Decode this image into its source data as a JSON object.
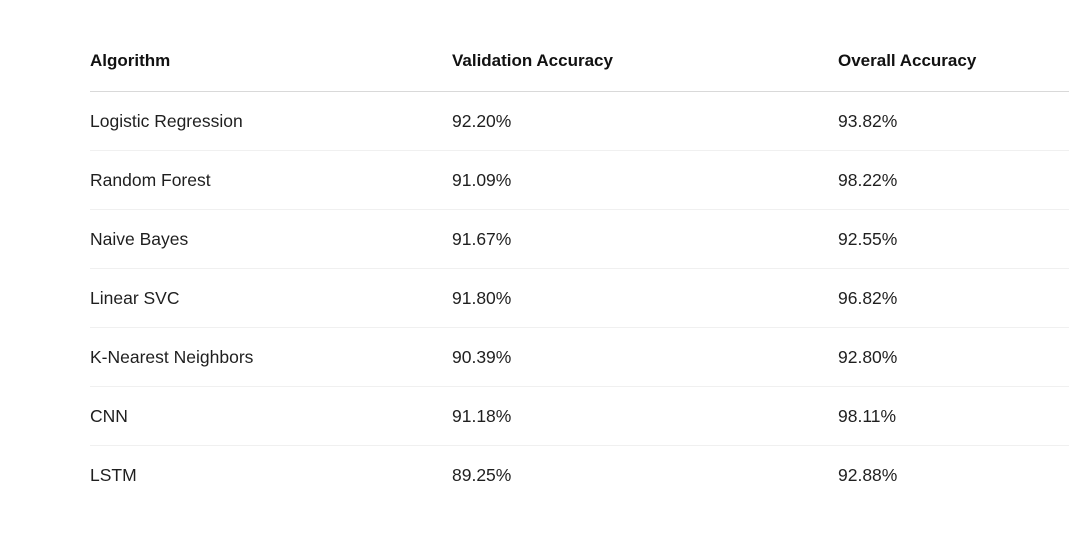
{
  "table": {
    "headers": [
      "Algorithm",
      "Validation Accuracy",
      "Overall Accuracy"
    ],
    "rows": [
      [
        "Logistic Regression",
        "92.20%",
        "93.82%"
      ],
      [
        "Random Forest",
        "91.09%",
        "98.22%"
      ],
      [
        "Naive Bayes",
        "91.67%",
        "92.55%"
      ],
      [
        "Linear SVC",
        "91.80%",
        "96.82%"
      ],
      [
        "K-Nearest Neighbors",
        "90.39%",
        "92.80%"
      ],
      [
        "CNN",
        "91.18%",
        "98.11%"
      ],
      [
        "LSTM",
        "89.25%",
        "92.88%"
      ]
    ]
  }
}
